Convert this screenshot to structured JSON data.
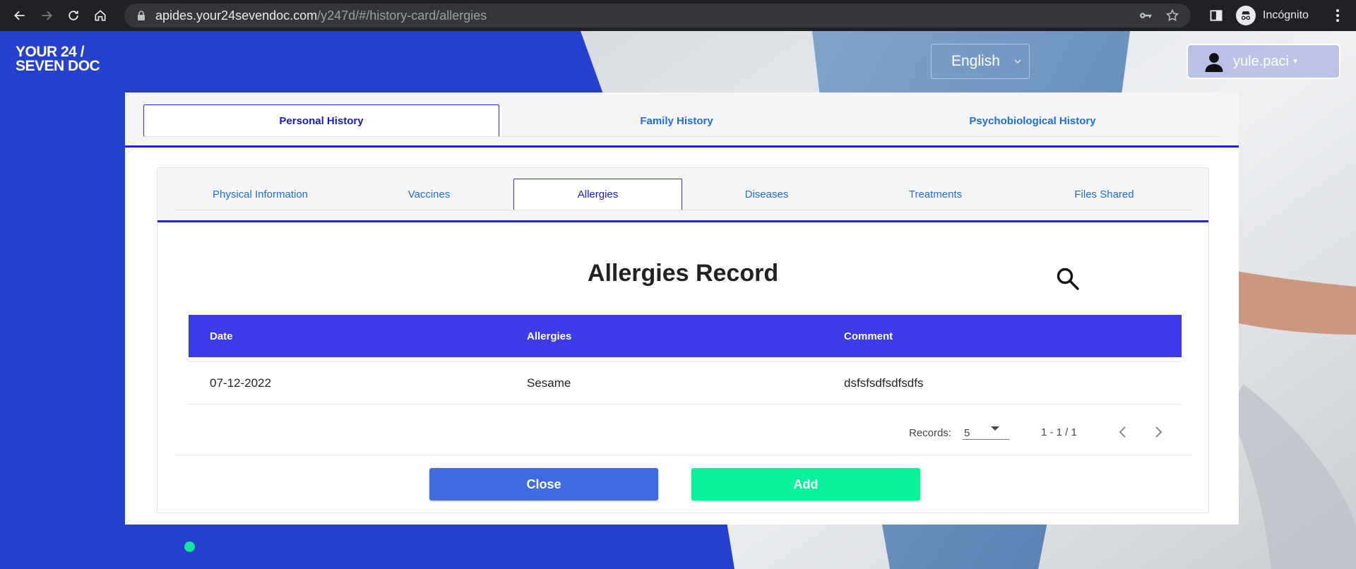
{
  "browser": {
    "url_host": "apides.your24sevendoc.com",
    "url_path": "/y247d/#/history-card/allergies",
    "profile_label": "Incógnito"
  },
  "header": {
    "logo_line1": "YOUR 24 /",
    "logo_line2": "SEVEN DOC",
    "language": "English",
    "username": "yule.paci"
  },
  "top_tabs": [
    {
      "label": "Personal History",
      "active": true
    },
    {
      "label": "Family History",
      "active": false
    },
    {
      "label": "Psychobiological History",
      "active": false
    }
  ],
  "sub_tabs": [
    {
      "label": "Physical Information",
      "active": false
    },
    {
      "label": "Vaccines",
      "active": false
    },
    {
      "label": "Allergies",
      "active": true
    },
    {
      "label": "Diseases",
      "active": false
    },
    {
      "label": "Treatments",
      "active": false
    },
    {
      "label": "Files Shared",
      "active": false
    }
  ],
  "record": {
    "title": "Allergies Record",
    "columns": [
      "Date",
      "Allergies",
      "Comment"
    ],
    "rows": [
      [
        "07-12-2022",
        "Sesame",
        "dsfsfsdfsdfsdfs"
      ]
    ]
  },
  "pagination": {
    "records_label": "Records:",
    "page_size": "5",
    "range": "1 - 1 / 1"
  },
  "buttons": {
    "close": "Close",
    "add": "Add"
  },
  "colors": {
    "brand_blue": "#2540cf",
    "table_header": "#3d3be8",
    "tab_accent": "#1f23d6",
    "close_button": "#3f6ae0",
    "add_button": "#06f29b"
  }
}
